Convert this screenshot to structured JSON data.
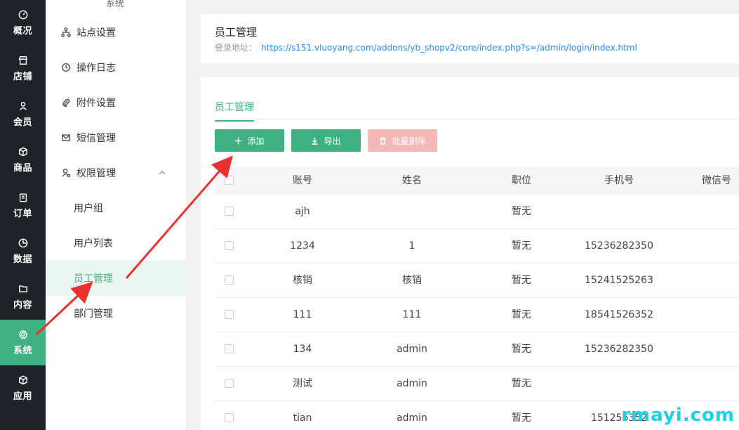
{
  "rail": {
    "items": [
      {
        "label": "概况",
        "icon": "dashboard-icon"
      },
      {
        "label": "店铺",
        "icon": "store-icon"
      },
      {
        "label": "会员",
        "icon": "user-icon"
      },
      {
        "label": "商品",
        "icon": "box-icon"
      },
      {
        "label": "订单",
        "icon": "clipboard-icon"
      },
      {
        "label": "数据",
        "icon": "pie-icon"
      },
      {
        "label": "内容",
        "icon": "folder-icon"
      },
      {
        "label": "系统",
        "icon": "gear-icon"
      },
      {
        "label": "应用",
        "icon": "cube-icon"
      }
    ],
    "active": "系统",
    "accent": "#3fb07f"
  },
  "submenu": {
    "header": "系统",
    "items": [
      {
        "label": "站点设置",
        "icon": "sitemap-icon"
      },
      {
        "label": "操作日志",
        "icon": "history-icon"
      },
      {
        "label": "附件设置",
        "icon": "paperclip-icon"
      },
      {
        "label": "短信管理",
        "icon": "mail-icon"
      },
      {
        "label": "权限管理",
        "icon": "user-gear-icon"
      }
    ],
    "sub_items": [
      {
        "label": "用户组"
      },
      {
        "label": "用户列表"
      },
      {
        "label": "员工管理"
      },
      {
        "label": "部门管理"
      }
    ],
    "active": "员工管理"
  },
  "header": {
    "title": "员工管理",
    "login_label": "登录地址：",
    "login_url": "https://s151.vluoyang.com/addons/yb_shopv2/core/index.php?s=/admin/login/index.html"
  },
  "tabs": [
    {
      "label": "员工管理"
    }
  ],
  "toolbar": {
    "add_label": "添加",
    "export_label": "导出",
    "batch_delete_label": "批量删除"
  },
  "table": {
    "columns": [
      "账号",
      "姓名",
      "职位",
      "手机号",
      "微信号"
    ],
    "rows": [
      {
        "account": "ajh",
        "name": "",
        "position": "暂无",
        "phone": ""
      },
      {
        "account": "1234",
        "name": "1",
        "position": "暂无",
        "phone": "15236282350"
      },
      {
        "account": "核销",
        "name": "核销",
        "position": "暂无",
        "phone": "15241525263"
      },
      {
        "account": "111",
        "name": "111",
        "position": "暂无",
        "phone": "18541526352"
      },
      {
        "account": "134",
        "name": "admin",
        "position": "暂无",
        "phone": "15236282350"
      },
      {
        "account": "测试",
        "name": "admin",
        "position": "暂无",
        "phone": ""
      },
      {
        "account": "tian",
        "name": "admin",
        "position": "暂无",
        "phone": "151256352"
      }
    ]
  },
  "watermark": "rmayi.com"
}
